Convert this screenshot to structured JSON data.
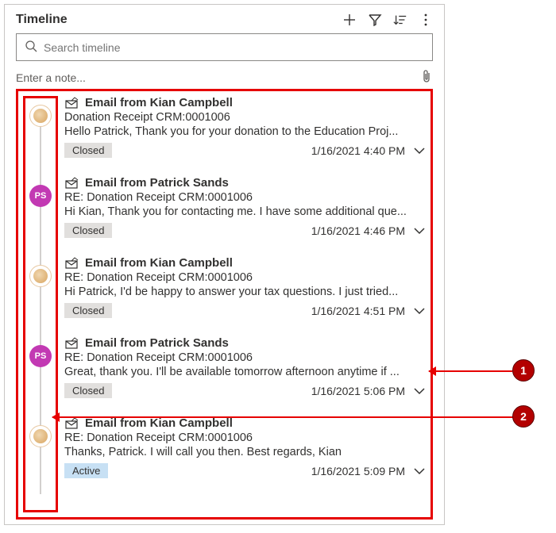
{
  "header": {
    "title": "Timeline"
  },
  "search": {
    "placeholder": "Search timeline"
  },
  "note": {
    "placeholder": "Enter a note..."
  },
  "entries": [
    {
      "avatar_type": "org",
      "avatar_initials": "",
      "title": "Email from Kian Campbell",
      "subject": "Donation Receipt CRM:0001006",
      "body": "Hello Patrick,   Thank you for your donation to the Education Proj...",
      "status": "Closed",
      "status_class": "closed",
      "timestamp": "1/16/2021 4:40 PM"
    },
    {
      "avatar_type": "person",
      "avatar_initials": "PS",
      "title": "Email from Patrick Sands",
      "subject": "RE: Donation Receipt CRM:0001006",
      "body": "Hi Kian, Thank you for contacting me. I have some additional que...",
      "status": "Closed",
      "status_class": "closed",
      "timestamp": "1/16/2021 4:46 PM"
    },
    {
      "avatar_type": "org",
      "avatar_initials": "",
      "title": "Email from Kian Campbell",
      "subject": "RE: Donation Receipt CRM:0001006",
      "body": "Hi Patrick,   I'd be happy to answer your tax questions. I just tried...",
      "status": "Closed",
      "status_class": "closed",
      "timestamp": "1/16/2021 4:51 PM"
    },
    {
      "avatar_type": "person",
      "avatar_initials": "PS",
      "title": "Email from Patrick Sands",
      "subject": "RE: Donation Receipt CRM:0001006",
      "body": "Great, thank you. I'll be available tomorrow afternoon anytime if ...",
      "status": "Closed",
      "status_class": "closed",
      "timestamp": "1/16/2021 5:06 PM"
    },
    {
      "avatar_type": "org",
      "avatar_initials": "",
      "title": "Email from Kian Campbell",
      "subject": "RE: Donation Receipt CRM:0001006",
      "body": "Thanks, Patrick. I will call you then.   Best regards, Kian",
      "status": "Active",
      "status_class": "active",
      "timestamp": "1/16/2021 5:09 PM"
    }
  ],
  "callouts": [
    {
      "num": "1"
    },
    {
      "num": "2"
    }
  ]
}
